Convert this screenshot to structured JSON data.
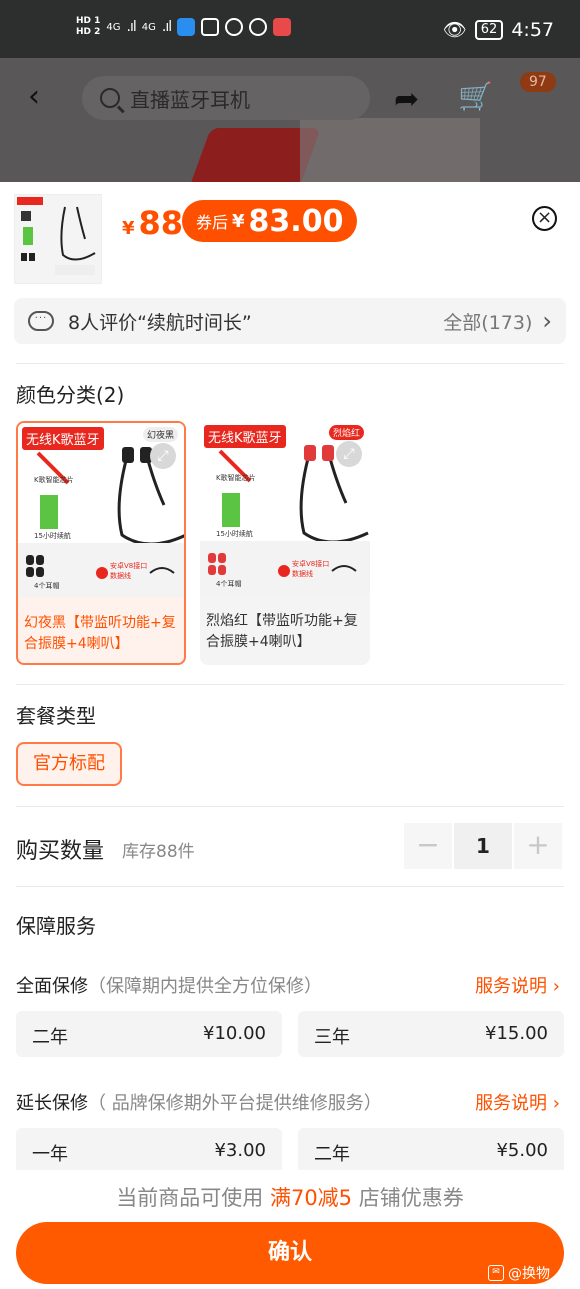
{
  "status_bar": {
    "hd1": "HD 1",
    "hd2": "HD 2",
    "net1": "4G",
    "net2": "4G",
    "battery": "62",
    "time": "4:57"
  },
  "header": {
    "search_placeholder": "直播蓝牙耳机",
    "cart_badge": "97"
  },
  "product": {
    "price_yen": "¥",
    "price": "88",
    "coupon_label": "券后",
    "coupon_yen": "¥",
    "coupon_price": "83.00"
  },
  "review": {
    "text": "8人评价“续航时间长”",
    "all": "全部(173)"
  },
  "color_section": {
    "title": "颜色分类(2)",
    "items": [
      {
        "tag": "无线K歌蓝牙",
        "corner": "幻夜黑",
        "caption": "幻夜黑【带监听功能+复合振膜+4喇叭】",
        "accent": "#222222",
        "selected": true
      },
      {
        "tag": "无线K歌蓝牙",
        "corner": "烈焰红",
        "caption": "烈焰红【带监听功能+复合振膜+4喇叭】",
        "accent": "#e23a3a",
        "selected": false
      }
    ],
    "mini_labels": [
      "K歌智能芯片",
      "15小时续航",
      "4个耳帽",
      "安卓V8接口数据线"
    ]
  },
  "package_section": {
    "title": "套餐类型",
    "option": "官方标配"
  },
  "quantity": {
    "title": "购买数量",
    "stock": "库存88件",
    "value": "1",
    "minus": "−",
    "plus": "+"
  },
  "service": {
    "title": "保障服务",
    "rows": [
      {
        "name": "全面保修",
        "desc": "（保障期内提供全方位保修）",
        "link": "服务说明",
        "options": [
          {
            "name": "二年",
            "price": "¥10.00"
          },
          {
            "name": "三年",
            "price": "¥15.00"
          }
        ]
      },
      {
        "name": "延长保修",
        "desc": "（ 品牌保修期外平台提供维修服务）",
        "link": "服务说明",
        "options": [
          {
            "name": "一年",
            "price": "¥3.00"
          },
          {
            "name": "二年",
            "price": "¥5.00"
          }
        ]
      }
    ]
  },
  "footer": {
    "coupon_pre": "当前商品可使用 ",
    "coupon_hl": "满70减5",
    "coupon_post": " 店铺优惠券",
    "confirm": "确认",
    "watermark": "@换物"
  },
  "colors": {
    "accent": "#ff5000",
    "confirm_bg": "#ff5a00"
  }
}
